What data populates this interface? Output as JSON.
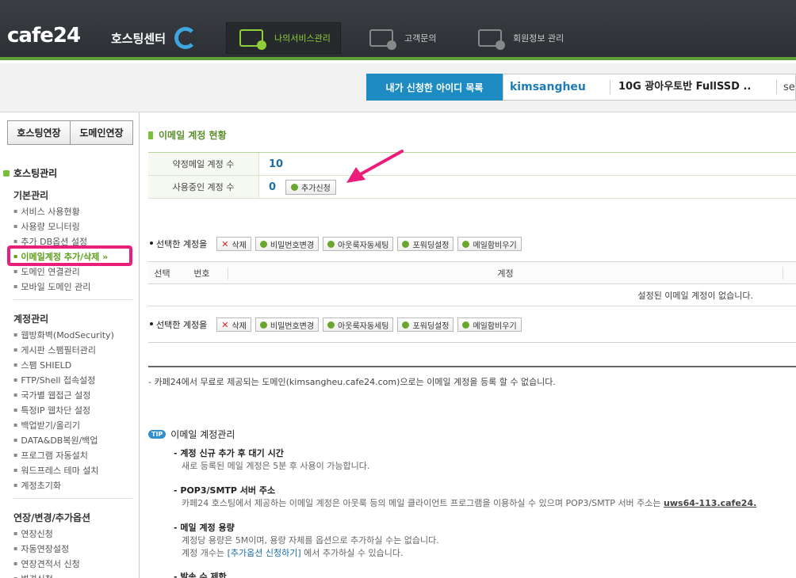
{
  "header": {
    "logo": "cafe24",
    "logo_sub": "호스팅센터",
    "nav": [
      {
        "label": "나의서비스관리",
        "active": true
      },
      {
        "label": "고객문의",
        "active": false
      },
      {
        "label": "회원정보 관리",
        "active": false
      }
    ]
  },
  "id_bar": {
    "label": "내가 신청한 아이디 목록",
    "user_id": "kimsangheu",
    "product": "10G 광아우토반 FullSSD ..",
    "select_partial": "se"
  },
  "sidebar": {
    "buttons": [
      "호스팅연장",
      "도메인연장"
    ],
    "section_title": "호스팅관리",
    "groups": [
      {
        "title": "기본관리",
        "items": [
          "서비스 사용현황",
          "사용량 모니터링",
          "추가 DB옵션 설정",
          "이메일계정 추가/삭제 »",
          "도메인 연결관리",
          "모바일 도메인 관리"
        ]
      },
      {
        "title": "계정관리",
        "items": [
          "웹방화벽(ModSecurity)",
          "게시판 스팸필터관리",
          "스팸 SHIELD",
          "FTP/Shell 접속설정",
          "국가별 웹접근 설정",
          "특정IP 웹차단 설정",
          "백업받기/올리기",
          "DATA&DB복원/백업",
          "프로그램 자동설치",
          "워드프레스 테마 설치",
          "계정초기화"
        ]
      },
      {
        "title": "연장/변경/추가옵션",
        "items": [
          "연장신청",
          "자동연장설정",
          "연장견적서 신청",
          "변경신청"
        ]
      }
    ],
    "highlight_index": 3
  },
  "content": {
    "title": "이메일 계정 현황",
    "stats": [
      {
        "label": "약정메일 계정 수",
        "value": "10"
      },
      {
        "label": "사용중인 계정 수",
        "value": "0"
      }
    ],
    "add_button": "추가신청",
    "action_label": "선택한 계정을",
    "actions": [
      "삭제",
      "비밀번호변경",
      "아웃룩자동세팅",
      "포워딩설정",
      "메일함비우기"
    ],
    "columns": [
      "선택",
      "번호",
      "계정"
    ],
    "empty_message": "설정된 이메일 계정이 없습니다.",
    "note": "- 카페24에서 무료로 제공되는 도메인(kimsangheu.cafe24.com)으로는 이메일 계정을 등록 할 수 없습니다.",
    "tip": {
      "badge": "TIP",
      "title": "이메일 계정관리",
      "items": [
        {
          "heading": "- 계정 신규 추가 후 대기 시간",
          "lines": [
            "새로 등록된 메일 계정은 5분 후 사용이 가능합니다."
          ]
        },
        {
          "heading": "- POP3/SMTP 서버 주소",
          "lines": [
            "카페24 호스팅에서 제공하는 이메일 계정은 아웃룩 등의 메일 클라이언트 프로그램을 이용하실 수 있으며 POP3/SMTP 서버 주소는 "
          ],
          "server": "uws64-113.cafe24."
        },
        {
          "heading": "- 메일 계정 용량",
          "lines": [
            "계정당 용량은 5M이며, 용량 자체를 옵션으로 추가하실 수는 없습니다."
          ],
          "line2_pre": "계정 개수는 ",
          "line2_link": "[추가옵션 신청하기]",
          "line2_post": " 에서 추가하실 수 있습니다."
        },
        {
          "heading": "- 발송 수 제한",
          "lines": []
        }
      ]
    }
  },
  "colors": {
    "accent_green": "#7bbf3a",
    "id_blue": "#1e8cc3",
    "highlight_pink": "#ea1f7c",
    "arrow_pink": "#ec1d7a"
  }
}
